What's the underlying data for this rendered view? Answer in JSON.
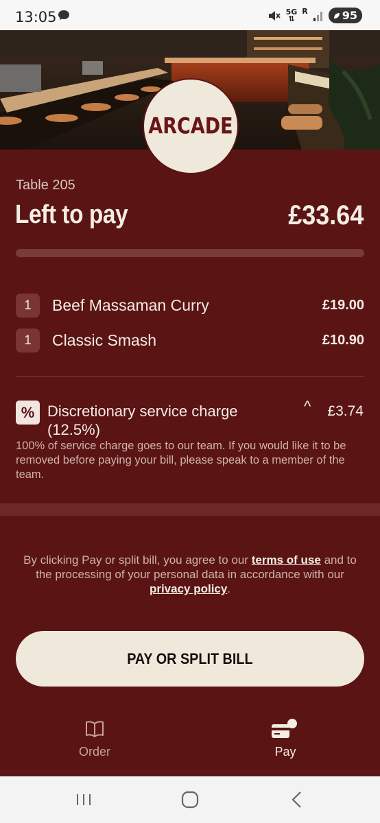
{
  "status_bar": {
    "time": "13:05",
    "network": "5G",
    "roaming": "R",
    "battery": "95",
    "icons": [
      "chat-icon",
      "mute-icon",
      "signal-icon",
      "battery-icon"
    ]
  },
  "brand": {
    "logo_text": "ARCADE",
    "primary_color": "#5a1414",
    "cream_color": "#efe9dc"
  },
  "bill": {
    "table_label": "Table 205",
    "left_to_pay_label": "Left to pay",
    "left_to_pay_amount": "£33.64",
    "paid_fraction": 0,
    "items": [
      {
        "qty": "1",
        "name": "Beef Massaman Curry",
        "price": "£19.00"
      },
      {
        "qty": "1",
        "name": "Classic Smash",
        "price": "£10.90"
      }
    ],
    "service_charge": {
      "icon": "%",
      "name": "Discretionary service charge (12.5%)",
      "price": "£3.74",
      "expanded": true,
      "note": "100% of service charge goes to our team. If you would like it to be removed before paying your bill, please speak to a member of the team."
    }
  },
  "terms": {
    "part1": "By clicking Pay or split bill, you agree to our ",
    "terms_link": "terms of use",
    "part2": " and to the processing of your personal data in accordance with our ",
    "privacy_link": "privacy policy",
    "part3": "."
  },
  "actions": {
    "pay_button": "PAY OR SPLIT BILL"
  },
  "tabs": [
    {
      "label": "Order",
      "icon": "book-icon",
      "active": false
    },
    {
      "label": "Pay",
      "icon": "card-icon",
      "active": true
    }
  ],
  "nav": [
    "recents-icon",
    "home-icon",
    "back-icon"
  ]
}
